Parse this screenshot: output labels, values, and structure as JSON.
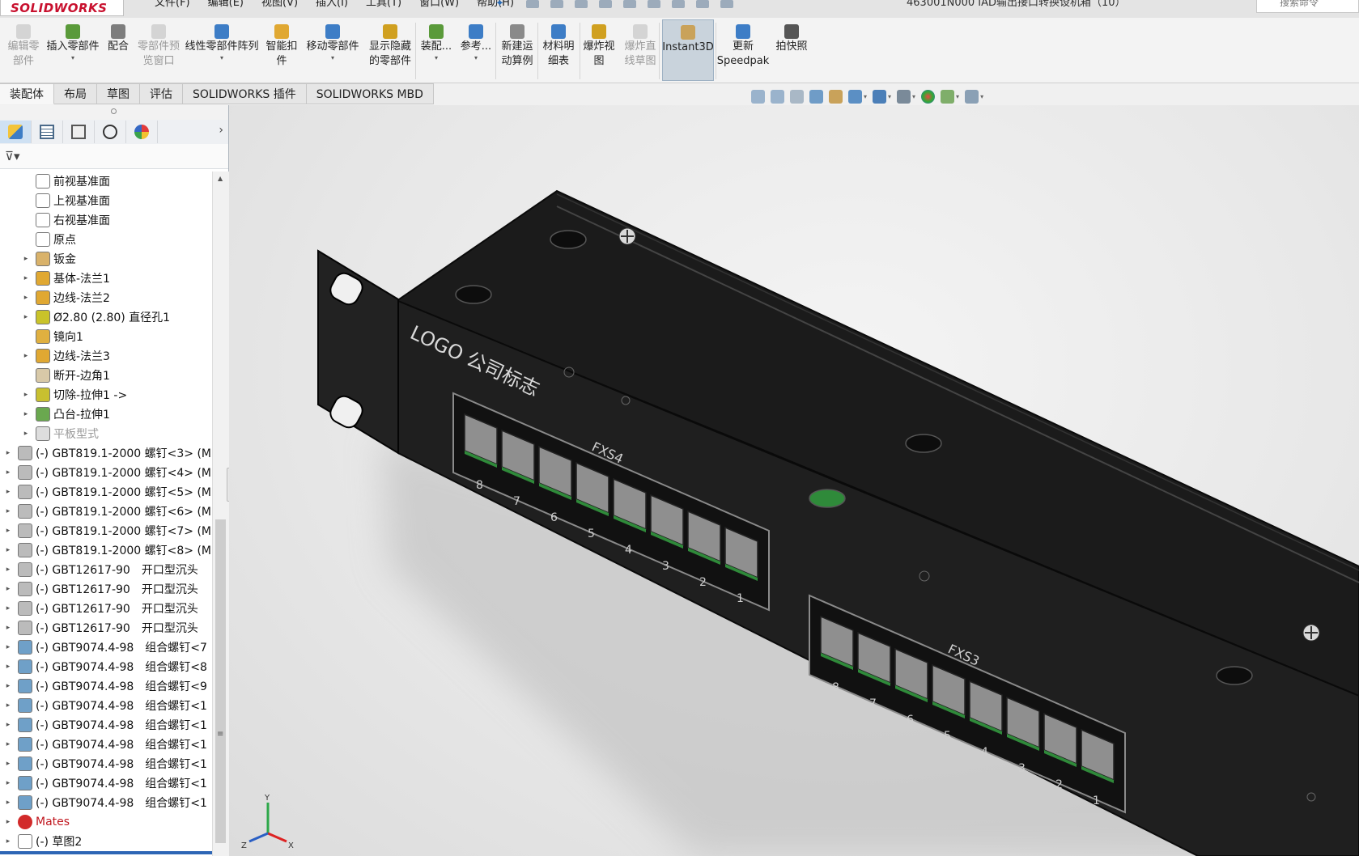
{
  "app": {
    "logo_text": "SOLIDWORKS",
    "document_title": "463001N000 IAD输出接口转换设机箱（10）",
    "search_placeholder": "搜索命令"
  },
  "menu": [
    "文件(F)",
    "编辑(E)",
    "视图(V)",
    "插入(I)",
    "工具(T)",
    "窗口(W)",
    "帮助(H)"
  ],
  "ribbon": [
    {
      "id": "edit-component",
      "label": "编辑零\n部件",
      "disabled": true,
      "caret": false
    },
    {
      "id": "insert-component",
      "label": "插入零部件",
      "disabled": false,
      "caret": true
    },
    {
      "id": "mate",
      "label": "配合",
      "disabled": false,
      "caret": false
    },
    {
      "id": "component-preview",
      "label": "零部件预\n览窗口",
      "disabled": true,
      "caret": false
    },
    {
      "id": "linear-pattern",
      "label": "线性零部件阵列",
      "disabled": false,
      "caret": true
    },
    {
      "id": "smart-fasteners",
      "label": "智能扣\n件",
      "disabled": false,
      "caret": false
    },
    {
      "id": "move-component",
      "label": "移动零部件",
      "disabled": false,
      "caret": true
    },
    {
      "id": "show-hidden",
      "label": "显示隐藏\n的零部件",
      "disabled": false,
      "caret": false
    },
    {
      "id": "assembly-features",
      "label": "装配...",
      "disabled": false,
      "caret": true
    },
    {
      "id": "reference-geometry",
      "label": "参考...",
      "disabled": false,
      "caret": true
    },
    {
      "id": "new-motion-study",
      "label": "新建运\n动算例",
      "disabled": false,
      "caret": false
    },
    {
      "id": "bill-of-materials",
      "label": "材料明\n细表",
      "disabled": false,
      "caret": false
    },
    {
      "id": "exploded-view",
      "label": "爆炸视\n图",
      "disabled": false,
      "caret": false
    },
    {
      "id": "explode-line-sketch",
      "label": "爆炸直\n线草图",
      "disabled": true,
      "caret": false
    },
    {
      "id": "instant3d",
      "label": "Instant3D",
      "disabled": false,
      "caret": false,
      "active": true
    },
    {
      "id": "update-speedpak",
      "label": "更新\nSpeedpak",
      "disabled": false,
      "caret": false
    },
    {
      "id": "take-snapshot",
      "label": "拍快照",
      "disabled": false,
      "caret": false
    }
  ],
  "tabs": [
    {
      "label": "装配体",
      "active": true
    },
    {
      "label": "布局",
      "active": false
    },
    {
      "label": "草图",
      "active": false
    },
    {
      "label": "评估",
      "active": false
    },
    {
      "label": "SOLIDWORKS 插件",
      "active": false
    },
    {
      "label": "SOLIDWORKS MBD",
      "active": false
    }
  ],
  "tree": [
    {
      "label": "前视基准面",
      "indent": 1,
      "expand": false,
      "icon": "plane-icon",
      "color": "#ffffff",
      "style": ""
    },
    {
      "label": "上视基准面",
      "indent": 1,
      "expand": false,
      "icon": "plane-icon",
      "color": "#ffffff",
      "style": ""
    },
    {
      "label": "右视基准面",
      "indent": 1,
      "expand": false,
      "icon": "plane-icon",
      "color": "#ffffff",
      "style": ""
    },
    {
      "label": "原点",
      "indent": 1,
      "expand": false,
      "icon": "origin-icon",
      "color": "#ffffff",
      "style": ""
    },
    {
      "label": "钣金",
      "indent": 1,
      "expand": true,
      "icon": "sheetmetal-icon",
      "color": "#d9b26a",
      "style": ""
    },
    {
      "label": "基体-法兰1",
      "indent": 1,
      "expand": true,
      "icon": "base-flange-icon",
      "color": "#e0a832",
      "style": ""
    },
    {
      "label": "边线-法兰2",
      "indent": 1,
      "expand": true,
      "icon": "edge-flange-icon",
      "color": "#e0a832",
      "style": ""
    },
    {
      "label": "Ø2.80 (2.80) 直径孔1",
      "indent": 1,
      "expand": true,
      "icon": "hole-icon",
      "color": "#c9c32a",
      "style": ""
    },
    {
      "label": "镜向1",
      "indent": 1,
      "expand": false,
      "icon": "mirror-icon",
      "color": "#e0b040",
      "style": ""
    },
    {
      "label": "边线-法兰3",
      "indent": 1,
      "expand": true,
      "icon": "edge-flange-icon",
      "color": "#e0a832",
      "style": ""
    },
    {
      "label": "断开-边角1",
      "indent": 1,
      "expand": false,
      "icon": "break-corner-icon",
      "color": "#d8c9a8",
      "style": ""
    },
    {
      "label": "切除-拉伸1 ->",
      "indent": 1,
      "expand": true,
      "icon": "cut-extrude-icon",
      "color": "#c8c030",
      "style": ""
    },
    {
      "label": "凸台-拉伸1",
      "indent": 1,
      "expand": true,
      "icon": "boss-extrude-icon",
      "color": "#6aa84f",
      "style": ""
    },
    {
      "label": "平板型式",
      "indent": 1,
      "expand": true,
      "icon": "flat-pattern-icon",
      "color": "#dddddd",
      "style": "dim"
    },
    {
      "label": "(-) GBT819.1-2000 螺钉<3> (M",
      "indent": 0,
      "expand": true,
      "icon": "screw-icon",
      "color": "#bbbbbb",
      "style": ""
    },
    {
      "label": "(-) GBT819.1-2000 螺钉<4> (M",
      "indent": 0,
      "expand": true,
      "icon": "screw-icon",
      "color": "#bbbbbb",
      "style": ""
    },
    {
      "label": "(-) GBT819.1-2000 螺钉<5> (M",
      "indent": 0,
      "expand": true,
      "icon": "screw-icon",
      "color": "#bbbbbb",
      "style": ""
    },
    {
      "label": "(-) GBT819.1-2000 螺钉<6> (M",
      "indent": 0,
      "expand": true,
      "icon": "screw-icon",
      "color": "#bbbbbb",
      "style": ""
    },
    {
      "label": "(-) GBT819.1-2000 螺钉<7> (M",
      "indent": 0,
      "expand": true,
      "icon": "screw-icon",
      "color": "#bbbbbb",
      "style": ""
    },
    {
      "label": "(-) GBT819.1-2000 螺钉<8> (M",
      "indent": 0,
      "expand": true,
      "icon": "screw-icon",
      "color": "#bbbbbb",
      "style": ""
    },
    {
      "label": "(-) GBT12617-90　开口型沉头",
      "indent": 0,
      "expand": true,
      "icon": "screw-icon",
      "color": "#bbbbbb",
      "style": ""
    },
    {
      "label": "(-) GBT12617-90　开口型沉头",
      "indent": 0,
      "expand": true,
      "icon": "screw-icon",
      "color": "#bbbbbb",
      "style": ""
    },
    {
      "label": "(-) GBT12617-90　开口型沉头",
      "indent": 0,
      "expand": true,
      "icon": "screw-icon",
      "color": "#bbbbbb",
      "style": ""
    },
    {
      "label": "(-) GBT12617-90　开口型沉头",
      "indent": 0,
      "expand": true,
      "icon": "screw-icon",
      "color": "#bbbbbb",
      "style": ""
    },
    {
      "label": "(-) GBT9074.4-98　组合螺钉<7",
      "indent": 0,
      "expand": true,
      "icon": "subassembly-icon",
      "color": "#6fa0c8",
      "style": ""
    },
    {
      "label": "(-) GBT9074.4-98　组合螺钉<8",
      "indent": 0,
      "expand": true,
      "icon": "subassembly-icon",
      "color": "#6fa0c8",
      "style": ""
    },
    {
      "label": "(-) GBT9074.4-98　组合螺钉<9",
      "indent": 0,
      "expand": true,
      "icon": "subassembly-icon",
      "color": "#6fa0c8",
      "style": ""
    },
    {
      "label": "(-) GBT9074.4-98　组合螺钉<1",
      "indent": 0,
      "expand": true,
      "icon": "subassembly-icon",
      "color": "#6fa0c8",
      "style": ""
    },
    {
      "label": "(-) GBT9074.4-98　组合螺钉<1",
      "indent": 0,
      "expand": true,
      "icon": "subassembly-icon",
      "color": "#6fa0c8",
      "style": ""
    },
    {
      "label": "(-) GBT9074.4-98　组合螺钉<1",
      "indent": 0,
      "expand": true,
      "icon": "subassembly-icon",
      "color": "#6fa0c8",
      "style": ""
    },
    {
      "label": "(-) GBT9074.4-98　组合螺钉<1",
      "indent": 0,
      "expand": true,
      "icon": "subassembly-icon",
      "color": "#6fa0c8",
      "style": ""
    },
    {
      "label": "(-) GBT9074.4-98　组合螺钉<1",
      "indent": 0,
      "expand": true,
      "icon": "subassembly-icon",
      "color": "#6fa0c8",
      "style": ""
    },
    {
      "label": "(-) GBT9074.4-98　组合螺钉<1",
      "indent": 0,
      "expand": true,
      "icon": "subassembly-icon",
      "color": "#6fa0c8",
      "style": ""
    },
    {
      "label": "Mates",
      "indent": 0,
      "expand": true,
      "icon": "mates-icon",
      "color": "#d22a2a",
      "style": "red"
    },
    {
      "label": "(-) 草图2",
      "indent": 0,
      "expand": true,
      "icon": "sketch-icon",
      "color": "#ffffff",
      "style": ""
    }
  ],
  "model": {
    "logo_text": "LOGO 公司标志",
    "port_groups": [
      {
        "label": "FXS4",
        "ports": [
          "8",
          "7",
          "6",
          "5",
          "4",
          "3",
          "2",
          "1"
        ]
      },
      {
        "label": "FXS3",
        "ports": [
          "8",
          "7",
          "6",
          "5",
          "4",
          "3",
          "2",
          "1"
        ]
      }
    ],
    "colors": {
      "panel": "#1c1c1c",
      "jack": "#8f8f8f",
      "pcb": "#2f8a3a",
      "accent": "#2a6bb5"
    }
  },
  "triad": {
    "x": "X",
    "y": "Y",
    "z": "Z"
  }
}
